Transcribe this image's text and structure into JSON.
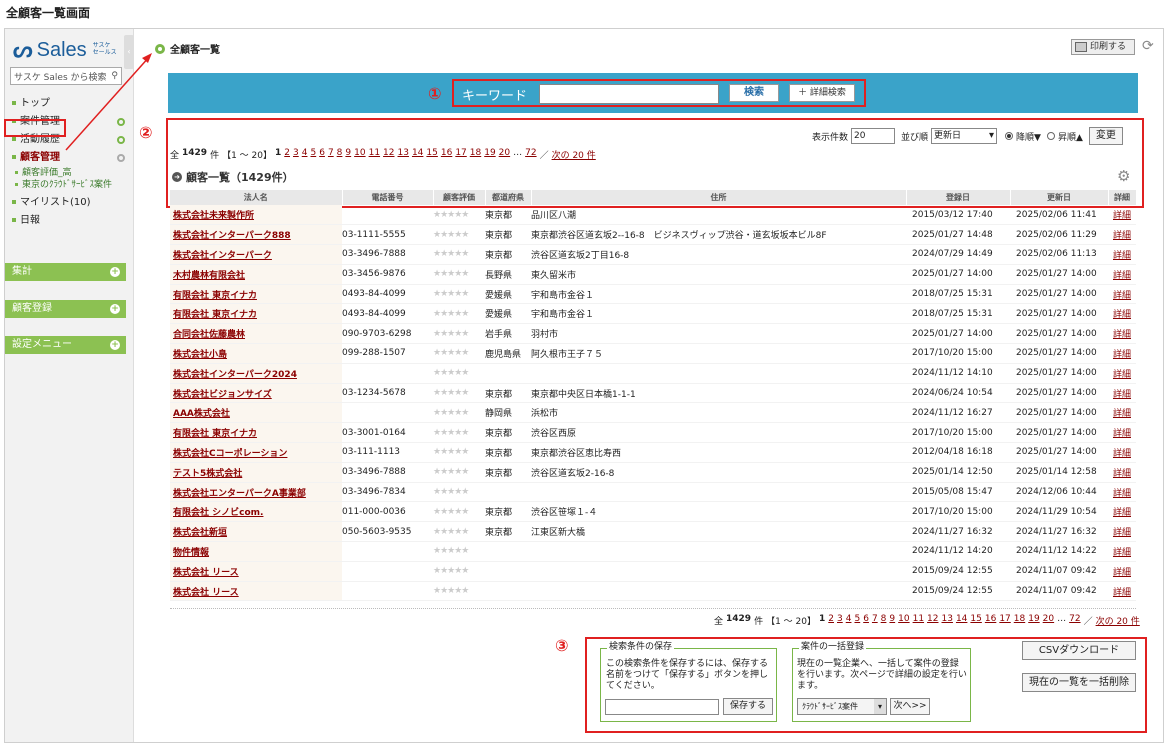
{
  "page_title": "全顧客一覧画面",
  "sidebar": {
    "logo_text": "Sales",
    "logo_sub1": "サスケ",
    "logo_sub2": "セールス",
    "search_placeholder": "サスケ Sales から検索",
    "items": [
      {
        "label": "トップ"
      },
      {
        "label": "案件管理"
      },
      {
        "label": "活動履歴"
      },
      {
        "label": "顧客管理"
      }
    ],
    "sub_items": [
      {
        "label": "顧客評価_高"
      },
      {
        "label": "東京のｸﾗｳﾄﾞｻｰﾋﾞｽ案件"
      }
    ],
    "items2": [
      {
        "label": "マイリスト(10)"
      },
      {
        "label": "日報"
      }
    ],
    "sections": [
      {
        "label": "集計"
      },
      {
        "label": "顧客登録"
      },
      {
        "label": "設定メニュー"
      }
    ]
  },
  "header": {
    "breadcrumb": "全顧客一覧",
    "print_label": "印刷する"
  },
  "search": {
    "keyword_label": "キーワード",
    "search_button": "検索",
    "detail_button": "＋ 詳細検索"
  },
  "badges": {
    "one": "①",
    "two": "②",
    "three": "③"
  },
  "controls": {
    "count_label": "表示件数",
    "count_value": "20",
    "sort_label": "並び順",
    "sort_value": "更新日",
    "desc_label": "降順▼",
    "asc_label": "昇順▲",
    "change_button": "変更"
  },
  "pager": {
    "prefix": "全",
    "total": "1429",
    "unit": "件",
    "range": "【1 ～ 20】",
    "current": "1",
    "pages": [
      "2",
      "3",
      "4",
      "5",
      "6",
      "7",
      "8",
      "9",
      "10",
      "11",
      "12",
      "13",
      "14",
      "15",
      "16",
      "17",
      "18",
      "19",
      "20"
    ],
    "ellipsis": "…",
    "last": "72",
    "slash": "／",
    "next": "次の 20 件"
  },
  "list": {
    "title": "顧客一覧（1429件）",
    "columns": [
      "法人名",
      "電話番号",
      "顧客評価",
      "都道府県",
      "住所",
      "登録日",
      "更新日",
      "詳細"
    ],
    "rows": [
      {
        "name": "株式会社未来製作所",
        "tel": "",
        "stars": "★★★★★",
        "pref": "東京都",
        "addr": "品川区八潮",
        "reg": "2015/03/12 17:40",
        "upd": "2025/02/06 11:41",
        "detail": "詳細"
      },
      {
        "name": "株式会社インターパーク888",
        "tel": "03-1111-5555",
        "stars": "★★★★★",
        "pref": "東京都",
        "addr": "東京都渋谷区道玄坂2--16-8　ビジネスヴィップ渋谷・道玄坂坂本ビル8F",
        "reg": "2025/01/27 14:48",
        "upd": "2025/02/06 11:29",
        "detail": "詳細"
      },
      {
        "name": "株式会社インターパーク",
        "tel": "03-3496-7888",
        "stars": "★★★★★",
        "pref": "東京都",
        "addr": "渋谷区道玄坂2丁目16-8",
        "reg": "2024/07/29 14:49",
        "upd": "2025/02/06 11:13",
        "detail": "詳細"
      },
      {
        "name": "木村農林有限会社",
        "tel": "03-3456-9876",
        "stars": "★★★★★",
        "pref": "長野県",
        "addr": "東久留米市",
        "reg": "2025/01/27 14:00",
        "upd": "2025/01/27 14:00",
        "detail": "詳細"
      },
      {
        "name": "有限会社 東京イナカ",
        "tel": "0493-84-4099",
        "stars": "★★★★★",
        "pref": "愛媛県",
        "addr": "宇和島市金谷１",
        "reg": "2018/07/25 15:31",
        "upd": "2025/01/27 14:00",
        "detail": "詳細"
      },
      {
        "name": "有限会社 東京イナカ",
        "tel": "0493-84-4099",
        "stars": "★★★★★",
        "pref": "愛媛県",
        "addr": "宇和島市金谷１",
        "reg": "2018/07/25 15:31",
        "upd": "2025/01/27 14:00",
        "detail": "詳細"
      },
      {
        "name": "合同会社佐藤農林",
        "tel": "090-9703-6298",
        "stars": "★★★★★",
        "pref": "岩手県",
        "addr": "羽村市",
        "reg": "2025/01/27 14:00",
        "upd": "2025/01/27 14:00",
        "detail": "詳細"
      },
      {
        "name": "株式会社小島",
        "tel": "099-288-1507",
        "stars": "★★★★★",
        "pref": "鹿児島県",
        "addr": "阿久根市王子７５",
        "reg": "2017/10/20 15:00",
        "upd": "2025/01/27 14:00",
        "detail": "詳細"
      },
      {
        "name": "株式会社インターパーク2024",
        "tel": "",
        "stars": "★★★★★",
        "pref": "",
        "addr": "",
        "reg": "2024/11/12 14:10",
        "upd": "2025/01/27 14:00",
        "detail": "詳細"
      },
      {
        "name": "株式会社ビジョンサイズ",
        "tel": "03-1234-5678",
        "stars": "★★★★★",
        "pref": "東京都",
        "addr": "東京都中央区日本橋1-1-1",
        "reg": "2024/06/24 10:54",
        "upd": "2025/01/27 14:00",
        "detail": "詳細"
      },
      {
        "name": "AAA株式会社",
        "tel": "",
        "stars": "★★★★★",
        "pref": "静岡県",
        "addr": "浜松市",
        "reg": "2024/11/12 16:27",
        "upd": "2025/01/27 14:00",
        "detail": "詳細"
      },
      {
        "name": "有限会社 東京イナカ",
        "tel": "03-3001-0164",
        "stars": "★★★★★",
        "pref": "東京都",
        "addr": "渋谷区西原",
        "reg": "2017/10/20 15:00",
        "upd": "2025/01/27 14:00",
        "detail": "詳細"
      },
      {
        "name": "株式会社Cコーポレーション",
        "tel": "03-111-1113",
        "stars": "★★★★★",
        "pref": "東京都",
        "addr": "東京都渋谷区恵比寿西",
        "reg": "2012/04/18 16:18",
        "upd": "2025/01/27 14:00",
        "detail": "詳細"
      },
      {
        "name": "テスト5株式会社",
        "tel": "03-3496-7888",
        "stars": "★★★★★",
        "pref": "東京都",
        "addr": "渋谷区道玄坂2-16-8",
        "reg": "2025/01/14 12:50",
        "upd": "2025/01/14 12:58",
        "detail": "詳細"
      },
      {
        "name": "株式会社エンターパークA事業部",
        "tel": "03-3496-7834",
        "stars": "★★★★★",
        "pref": "",
        "addr": "",
        "reg": "2015/05/08 15:47",
        "upd": "2024/12/06 10:44",
        "detail": "詳細"
      },
      {
        "name": "有限会社 シノビcom.",
        "tel": "011-000-0036",
        "stars": "★★★★★",
        "pref": "東京都",
        "addr": "渋谷区笹塚１-４",
        "reg": "2017/10/20 15:00",
        "upd": "2024/11/29 10:54",
        "detail": "詳細"
      },
      {
        "name": "株式会社新垣",
        "tel": "050-5603-9535",
        "stars": "★★★★★",
        "pref": "東京都",
        "addr": "江東区新大橋",
        "reg": "2024/11/27 16:32",
        "upd": "2024/11/27 16:32",
        "detail": "詳細"
      },
      {
        "name": "物件情報",
        "tel": "",
        "stars": "★★★★★",
        "pref": "",
        "addr": "",
        "reg": "2024/11/12 14:20",
        "upd": "2024/11/12 14:22",
        "detail": "詳細"
      },
      {
        "name": "株式会社 リース",
        "tel": "",
        "stars": "★★★★★",
        "pref": "",
        "addr": "",
        "reg": "2015/09/24 12:55",
        "upd": "2024/11/07 09:42",
        "detail": "詳細"
      },
      {
        "name": "株式会社 リース",
        "tel": "",
        "stars": "★★★★★",
        "pref": "",
        "addr": "",
        "reg": "2015/09/24 12:55",
        "upd": "2024/11/07 09:42",
        "detail": "詳細"
      }
    ]
  },
  "save_panel": {
    "legend": "検索条件の保存",
    "text": "この検索条件を保存するには、保存する名前をつけて「保存する」ボタンを押してください。",
    "button": "保存する"
  },
  "bulk_panel": {
    "legend": "案件の一括登録",
    "text": "現在の一覧企業へ、一括して案件の登録を行います。次ページで詳細の設定を行います。",
    "select_value": "ｸﾗｳﾄﾞｻｰﾋﾞｽ案件",
    "next_button": "次へ>>"
  },
  "csv_button": "CSVダウンロード",
  "bulk_delete_button": "現在の一覧を一括削除",
  "colors": {
    "accent": "#3aa3c9",
    "green": "#8cc152",
    "link": "#8b0000",
    "highlight": "#e02020"
  }
}
